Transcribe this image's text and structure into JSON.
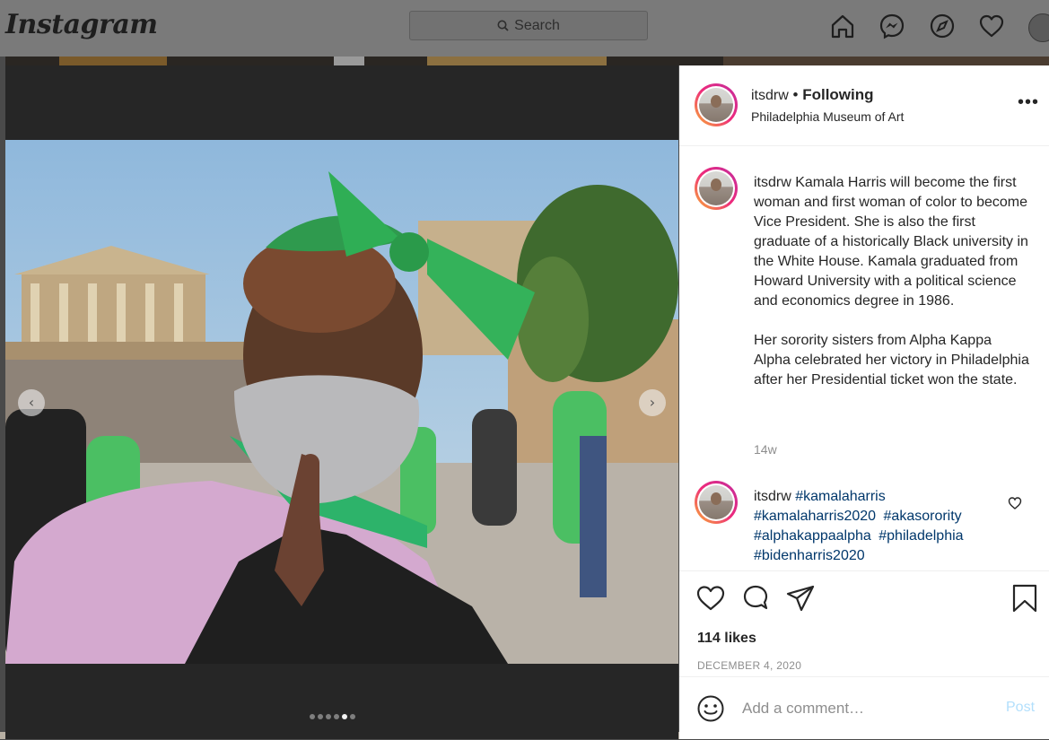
{
  "nav": {
    "logo": "Instagram",
    "search_placeholder": "Search",
    "icons": [
      "home-icon",
      "messenger-icon",
      "explore-icon",
      "activity-heart-icon",
      "profile-avatar"
    ]
  },
  "photo": {
    "slide_count": 6,
    "active_slide": 5,
    "prev_label": "‹",
    "next_label": "›"
  },
  "post": {
    "username": "itsdrw",
    "separator": "•",
    "follow_status": "Following",
    "location": "Philadelphia Museum of Art",
    "caption_paragraphs": [
      "Kamala Harris will become the first woman and first woman of color to become Vice President. She is also the first graduate of a historically Black university in the White House. Kamala graduated from Howard University with a political science and economics degree in 1986.",
      "Her sorority sisters from Alpha Kappa Alpha celebrated her victory in Philadelphia after her Presidential ticket won the state."
    ],
    "caption_time": "14w",
    "comment": {
      "username": "itsdrw",
      "hashtags": [
        "#kamalaharris",
        "#kamalaharris2020",
        "#akasorority",
        "#alphakappaalpha",
        "#philadelphia",
        "#bidenharris2020"
      ]
    },
    "likes": "114 likes",
    "date": "DECEMBER 4, 2020",
    "comment_placeholder": "Add a comment…",
    "post_label": "Post"
  },
  "colors": {
    "link": "#00376b",
    "post_disabled": "#b2dffc",
    "muted": "#8e8e8e"
  }
}
